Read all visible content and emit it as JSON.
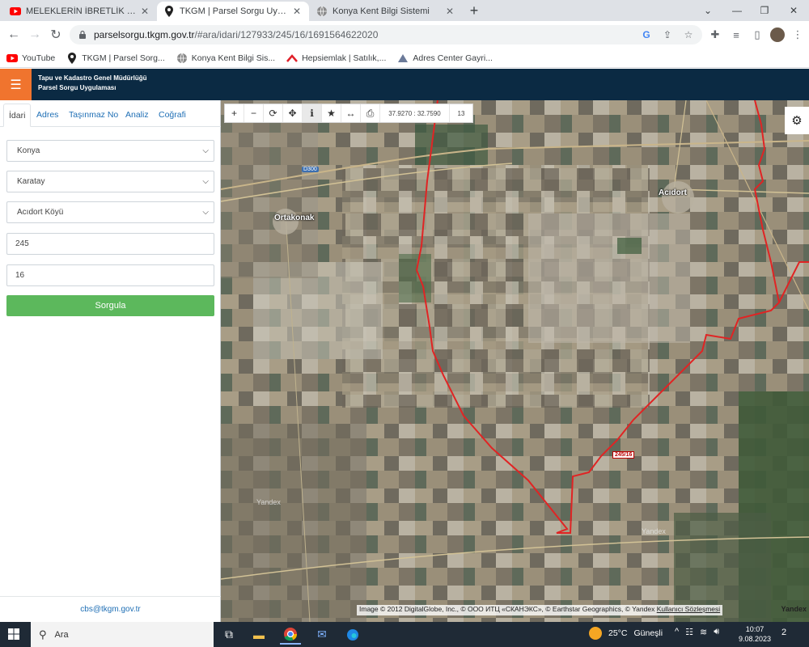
{
  "browser": {
    "tabs": [
      {
        "label": "MELEKLERİN İBRETLİK HALLERİ -",
        "icon": "youtube-icon",
        "active": false
      },
      {
        "label": "TKGM | Parsel Sorgu Uygulaması",
        "icon": "map-pin-icon",
        "active": true
      },
      {
        "label": "Konya Kent Bilgi Sistemi",
        "icon": "globe-icon",
        "active": false
      }
    ],
    "url_host": "parselsorgu.tkgm.gov.tr",
    "url_path": "/#ara/idari/127933/245/16/1691564622020",
    "bookmarks": [
      {
        "label": "YouTube",
        "icon": "youtube-icon"
      },
      {
        "label": "TKGM | Parsel Sorg...",
        "icon": "map-pin-icon"
      },
      {
        "label": "Konya Kent Bilgi Sis...",
        "icon": "globe-icon"
      },
      {
        "label": "Hepsiemlak | Satılık,...",
        "icon": "hepsiemlak-icon"
      },
      {
        "label": "Adres Center Gayri...",
        "icon": "adres-center-icon"
      }
    ]
  },
  "app": {
    "title_line1": "Tapu ve Kadastro Genel Müdürlüğü",
    "title_line2": "Parsel Sorgu Uygulaması",
    "accent": "#f0742e",
    "header_bg": "#0b2a43"
  },
  "panel": {
    "tabs": [
      "İdari",
      "Adres",
      "Taşınmaz No",
      "Analiz",
      "Coğrafi"
    ],
    "active_tab": "İdari",
    "province": "Konya",
    "district": "Karatay",
    "neighborhood": "Acıdort Köyü",
    "block_no": "245",
    "parcel_no": "16",
    "query_label": "Sorgula",
    "query_color": "#5cb85c",
    "footer_email": "cbs@tkgm.gov.tr"
  },
  "map": {
    "tools": [
      "zoom-in-icon",
      "zoom-out-icon",
      "refresh-icon",
      "locate-icon",
      "info-icon",
      "star-icon",
      "measure-icon",
      "print-icon"
    ],
    "coordinates": "37.9270 : 32.7590",
    "zoom": "13",
    "places": [
      "Ortakonak",
      "Acıdort",
      "Yandex",
      "Yandex"
    ],
    "road_labels": [
      "D300"
    ],
    "parcel_label": "245/16",
    "boundary_color": "#e02424",
    "attribution": "Image © 2012 DigitalGlobe, Inc., © ООО ИТЦ «СКАНЭКС», © Earthstar Geographics, © Yandex",
    "attribution_link": "Kullanıcı Sözleşmesi",
    "provider": "Yandex"
  },
  "taskbar": {
    "search_placeholder": "Ara",
    "weather_temp": "25°C",
    "weather_text": "Güneşli",
    "time": "10:07",
    "date": "9.08.2023",
    "notif_count": "2"
  }
}
